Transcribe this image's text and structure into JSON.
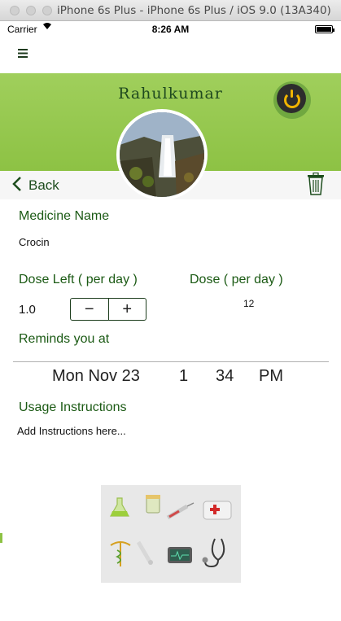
{
  "window": {
    "title": "iPhone 6s Plus - iPhone 6s Plus / iOS 9.0 (13A340)"
  },
  "status_bar": {
    "carrier": "Carrier",
    "time": "8:26 AM"
  },
  "profile": {
    "name": "Rahulkumar"
  },
  "nav": {
    "back_label": "Back"
  },
  "medicine": {
    "name_label": "Medicine Name",
    "name_value": "Crocin",
    "dose_left_label": "Dose Left ( per day )",
    "dose_left_value": "1.0",
    "dose_label": "Dose ( per day )",
    "dose_value": "12",
    "stepper_minus": "−",
    "stepper_plus": "+",
    "reminder_label": "Reminds you at"
  },
  "time_picker": {
    "date": "Mon Nov 23",
    "hour": "1",
    "minute": "34",
    "period": "PM"
  },
  "usage": {
    "label": "Usage Instructions",
    "placeholder": "Add Instructions here..."
  },
  "icons": [
    "hamburger-icon",
    "power-icon",
    "back-chevron-icon",
    "trash-icon",
    "wifi-icon",
    "battery-icon",
    "medical-illustration"
  ],
  "colors": {
    "header_green": "#8dc244",
    "label_green": "#1b5a14",
    "power_accent": "#f2b400"
  }
}
